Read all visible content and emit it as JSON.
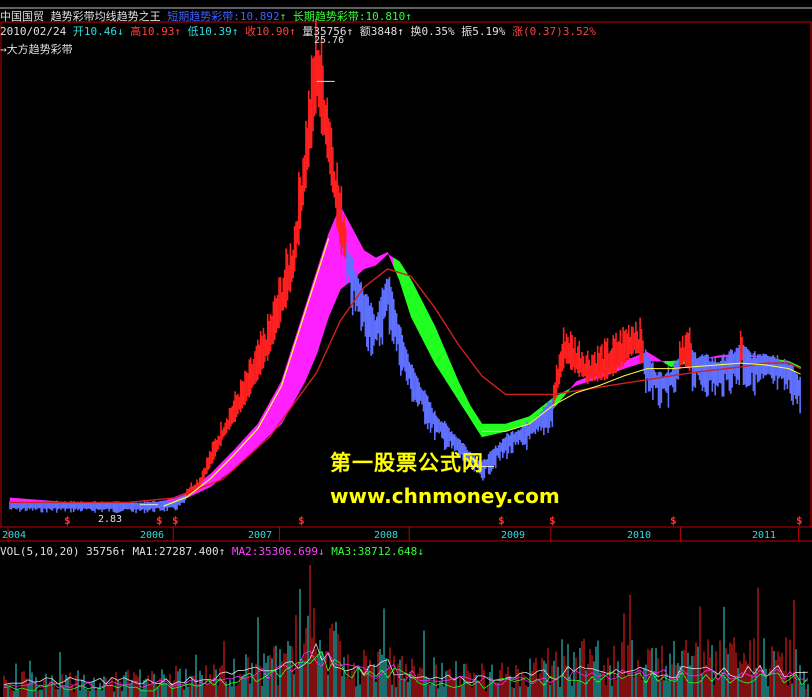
{
  "header": {
    "stock_name": "中国国贸",
    "indicator_name": "趋势彩带均线趋势之王",
    "short_band_label": "短期趋势彩带:",
    "short_band_value": "10.892",
    "short_band_arrow": "↑",
    "long_band_label": "长期趋势彩带:",
    "long_band_value": "10.810",
    "long_band_arrow": "↑"
  },
  "quote": {
    "date": "2010/02/24",
    "open_label": "开",
    "open": "10.46",
    "open_arrow": "↓",
    "high_label": "高",
    "high": "10.93",
    "high_arrow": "↑",
    "low_label": "低",
    "low": "10.39",
    "low_arrow": "↑",
    "close_label": "收",
    "close": "10.90",
    "close_arrow": "↑",
    "vol_label": "量",
    "volume": "35756",
    "vol_arrow": "↑",
    "amount_label": "额",
    "amount": "3848",
    "amount_arrow": "↑",
    "turnover_label": "换",
    "turnover": "0.35%",
    "amplitude_label": "振",
    "amplitude": "5.19%",
    "change_label": "涨",
    "change": "(0.37)",
    "change_pct": "3.52%"
  },
  "band_label": "→大方趋势彩带",
  "annotations": {
    "high_price": "25.76",
    "low_price": "2.83"
  },
  "years": [
    "2004",
    "2006",
    "2007",
    "2008",
    "2009",
    "2010",
    "2011"
  ],
  "volume_panel": {
    "title": "VOL(5,10,20)",
    "value": "35756",
    "value_arrow": "↑",
    "ma1_label": "MA1:",
    "ma1": "27287.400",
    "ma1_arrow": "↑",
    "ma2_label": "MA2:",
    "ma2": "35306.699",
    "ma2_arrow": "↓",
    "ma3_label": "MA3:",
    "ma3": "38712.648",
    "ma3_arrow": "↓"
  },
  "watermark": {
    "line1": "第一股票公式网",
    "line2": "www.chnmoney.com"
  },
  "colors": {
    "background": "#000000",
    "border": "#c00000",
    "rising": "#ff2020",
    "falling": "#6070ff",
    "short_band": "#ff20ff",
    "long_band": "#20ff20",
    "long_ma": "#d02020",
    "short_ma": "#ffff40",
    "axis_text": "#33dcdc",
    "watermark": "#ffff00"
  },
  "chart_data": {
    "type": "line",
    "price_curve": [
      [
        0,
        2.9
      ],
      [
        4,
        2.88
      ],
      [
        8,
        2.86
      ],
      [
        11,
        2.83
      ],
      [
        14,
        2.95
      ],
      [
        16,
        3.8
      ],
      [
        18,
        6.5
      ],
      [
        20,
        8.8
      ],
      [
        22,
        11.5
      ],
      [
        24,
        15.5
      ],
      [
        25,
        20.5
      ],
      [
        26,
        25.76
      ],
      [
        27,
        22.0
      ],
      [
        28,
        17.5
      ],
      [
        29,
        15.5
      ],
      [
        30,
        13.8
      ],
      [
        31,
        12.5
      ],
      [
        32,
        14.8
      ],
      [
        33,
        12.0
      ],
      [
        34,
        10.0
      ],
      [
        36,
        7.5
      ],
      [
        38,
        6.2
      ],
      [
        39,
        5.5
      ],
      [
        40,
        4.9
      ],
      [
        42,
        6.3
      ],
      [
        44,
        7.0
      ],
      [
        46,
        8.2
      ],
      [
        47,
        11.0
      ],
      [
        49,
        9.8
      ],
      [
        51,
        10.3
      ],
      [
        53,
        11.5
      ],
      [
        55,
        9.5
      ],
      [
        56,
        9.8
      ],
      [
        57,
        10.8
      ],
      [
        60,
        10.2
      ],
      [
        62,
        11.0
      ],
      [
        63,
        10.5
      ],
      [
        64,
        10.7
      ],
      [
        66,
        10.2
      ],
      [
        67,
        9.2
      ]
    ],
    "long_ma_curve": [
      [
        0,
        2.95
      ],
      [
        10,
        2.95
      ],
      [
        14,
        3.2
      ],
      [
        18,
        4.2
      ],
      [
        22,
        6.5
      ],
      [
        26,
        10.0
      ],
      [
        28,
        12.8
      ],
      [
        30,
        14.6
      ],
      [
        32,
        15.6
      ],
      [
        34,
        15.2
      ],
      [
        36,
        13.5
      ],
      [
        38,
        11.5
      ],
      [
        40,
        9.8
      ],
      [
        42,
        8.8
      ],
      [
        46,
        8.8
      ],
      [
        50,
        9.2
      ],
      [
        54,
        9.6
      ],
      [
        58,
        10.0
      ],
      [
        62,
        10.3
      ],
      [
        64,
        10.5
      ],
      [
        66,
        10.5
      ],
      [
        67,
        10.2
      ]
    ],
    "band_short": [
      [
        0,
        3.2
      ],
      [
        6,
        2.9
      ],
      [
        10,
        2.85
      ],
      [
        13,
        3.0
      ],
      [
        15,
        3.5
      ],
      [
        17,
        4.5
      ],
      [
        19,
        5.8
      ],
      [
        21,
        7.2
      ],
      [
        23,
        9.5
      ],
      [
        25,
        13.5
      ],
      [
        26,
        15.5
      ],
      [
        27,
        17.5
      ],
      [
        28,
        19.0
      ],
      [
        29,
        17.8
      ],
      [
        30,
        16.6
      ],
      [
        31,
        16.2
      ],
      [
        32,
        16.5
      ],
      [
        33,
        15.0
      ],
      [
        34,
        13.0
      ],
      [
        36,
        10.5
      ],
      [
        38,
        8.5
      ],
      [
        39,
        7.5
      ],
      [
        40,
        6.5
      ],
      [
        42,
        6.8
      ],
      [
        44,
        7.2
      ],
      [
        46,
        8.0
      ],
      [
        48,
        9.5
      ],
      [
        50,
        10.0
      ],
      [
        52,
        10.6
      ],
      [
        54,
        11.1
      ],
      [
        56,
        10.3
      ],
      [
        58,
        10.6
      ],
      [
        60,
        10.9
      ],
      [
        62,
        11.0
      ],
      [
        64,
        10.8
      ],
      [
        66,
        10.5
      ],
      [
        67,
        10.2
      ]
    ],
    "band_long": [
      [
        0,
        3.0
      ],
      [
        6,
        2.95
      ],
      [
        10,
        2.85
      ],
      [
        13,
        2.95
      ],
      [
        15,
        3.2
      ],
      [
        17,
        3.8
      ],
      [
        19,
        4.8
      ],
      [
        21,
        6.0
      ],
      [
        23,
        7.2
      ],
      [
        25,
        9.5
      ],
      [
        26,
        11.0
      ],
      [
        27,
        13.0
      ],
      [
        28,
        14.5
      ],
      [
        29,
        15.0
      ],
      [
        30,
        15.6
      ],
      [
        31,
        15.8
      ],
      [
        32,
        16.4
      ],
      [
        33,
        16.0
      ],
      [
        34,
        15.0
      ],
      [
        36,
        12.5
      ],
      [
        38,
        9.5
      ],
      [
        39,
        8.2
      ],
      [
        40,
        7.2
      ],
      [
        42,
        7.2
      ],
      [
        44,
        7.6
      ],
      [
        46,
        8.6
      ],
      [
        48,
        9.3
      ],
      [
        50,
        9.7
      ],
      [
        52,
        10.2
      ],
      [
        54,
        10.6
      ],
      [
        56,
        10.6
      ],
      [
        58,
        10.7
      ],
      [
        60,
        10.8
      ],
      [
        62,
        10.9
      ],
      [
        64,
        10.8
      ],
      [
        66,
        10.6
      ],
      [
        67,
        10.3
      ]
    ],
    "year_ticks": [
      [
        "2004",
        0
      ],
      [
        "2006",
        14
      ],
      [
        "2007",
        23
      ],
      [
        "2008",
        34
      ],
      [
        "2009",
        46
      ],
      [
        "2010",
        57
      ],
      [
        "2011",
        67
      ]
    ],
    "buy_signals": [
      5,
      14,
      16,
      26,
      46,
      50,
      57,
      62,
      67
    ],
    "ylim": [
      2,
      28
    ]
  }
}
